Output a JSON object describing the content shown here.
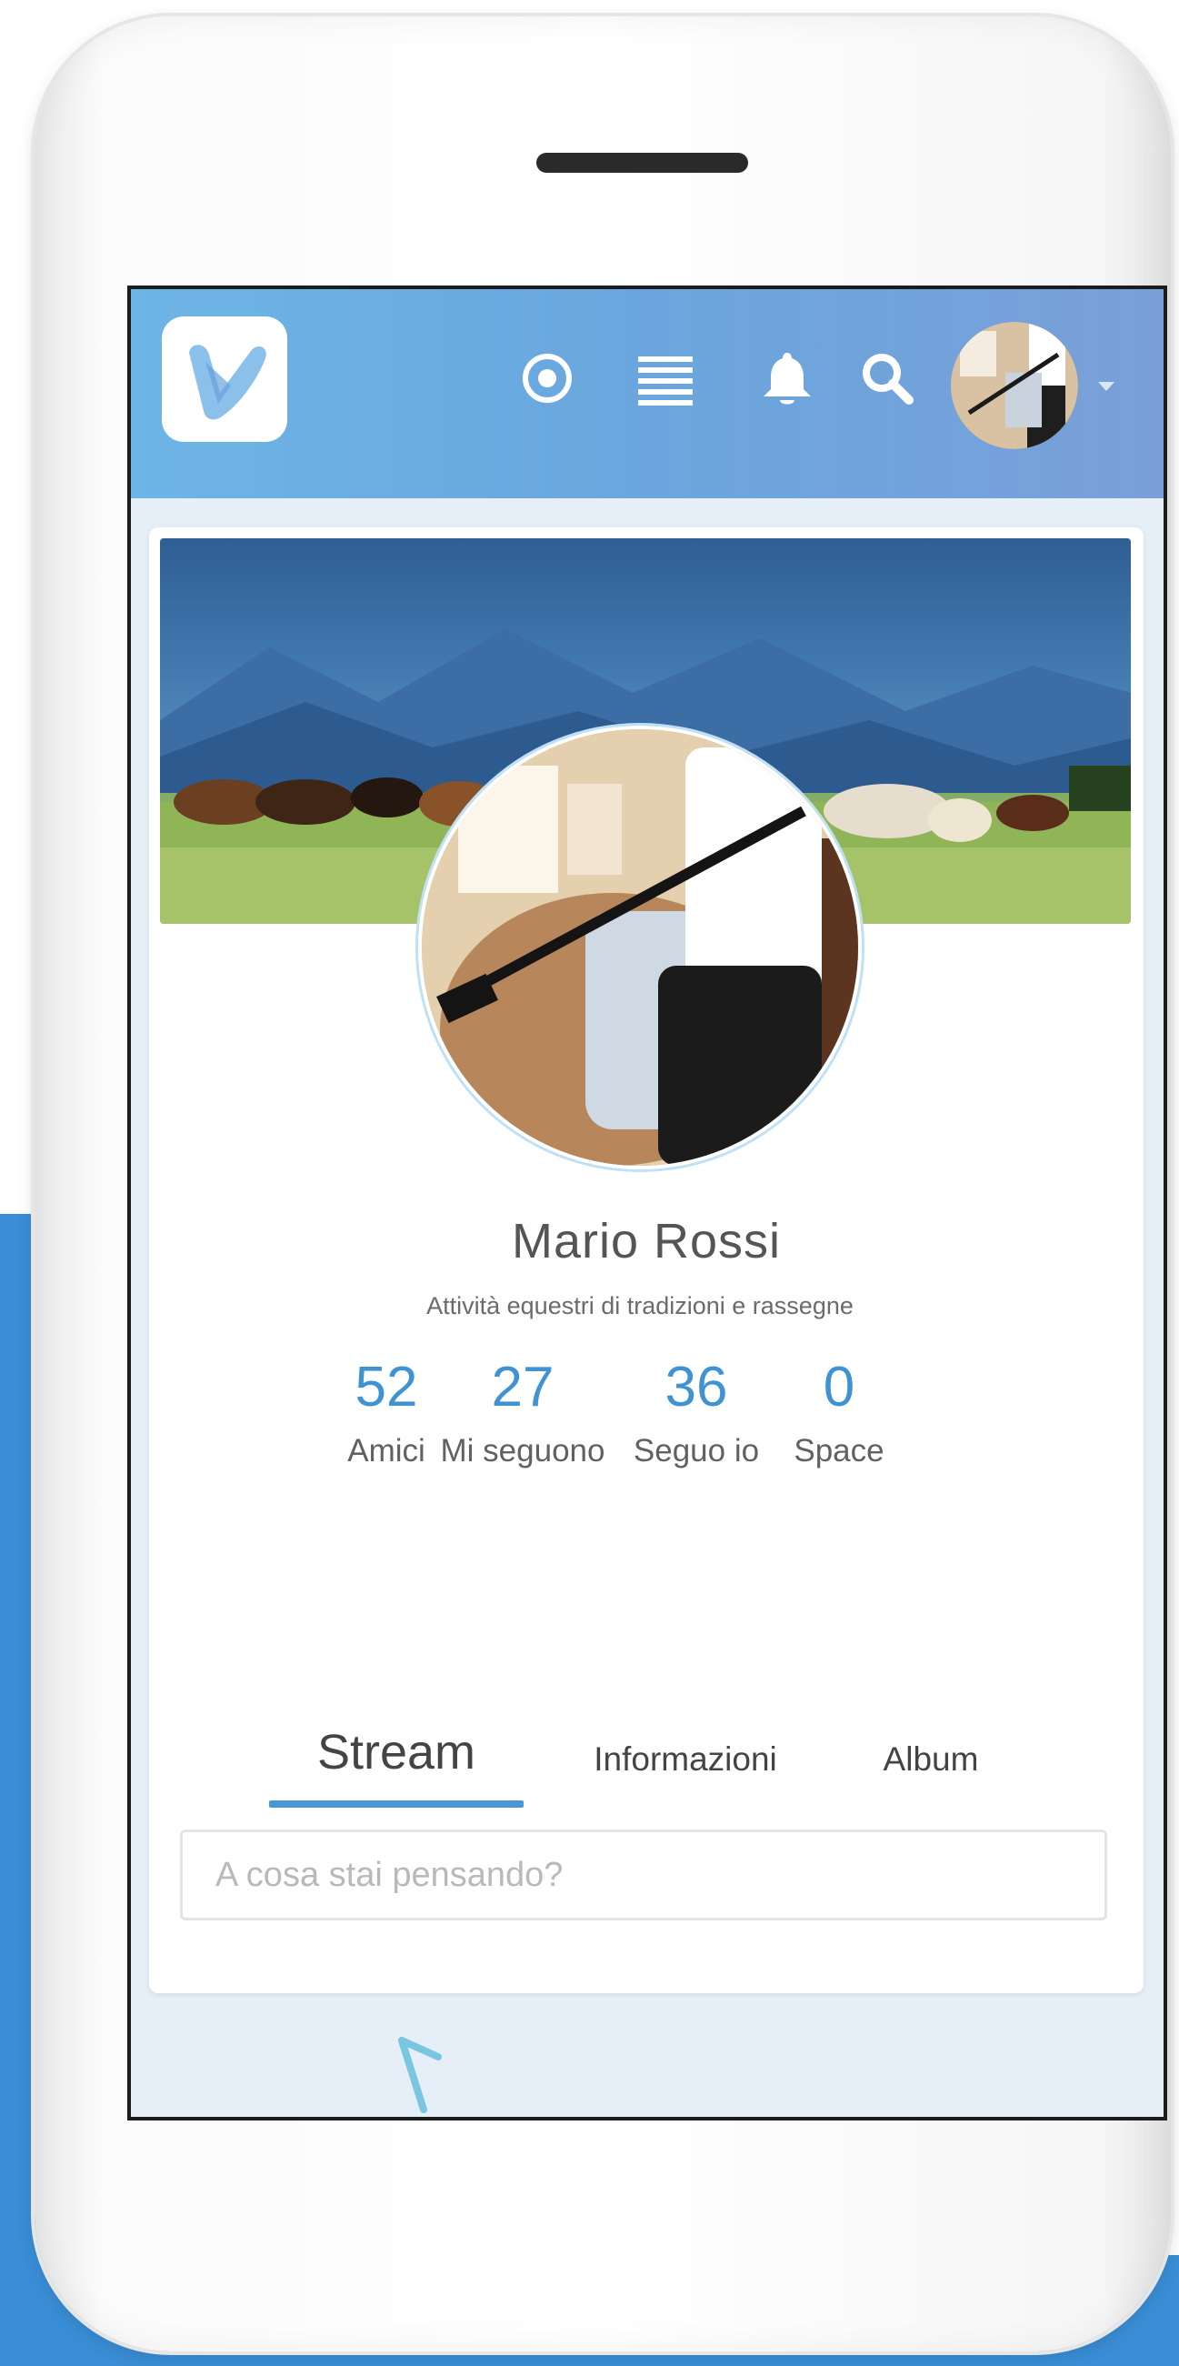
{
  "app": {
    "logo_letter": "V",
    "header_icons": [
      "target-icon",
      "menu-lines-icon",
      "bell-icon",
      "search-icon",
      "avatar"
    ],
    "accent_color": "#3f93d3"
  },
  "profile": {
    "name": "Mario Rossi",
    "bio": "Attività equestri di tradizioni e rassegne",
    "stats": [
      {
        "value": "52",
        "label": "Amici"
      },
      {
        "value": "27",
        "label": "Mi seguono"
      },
      {
        "value": "36",
        "label": "Seguo io"
      },
      {
        "value": "0",
        "label": "Space"
      }
    ]
  },
  "tabs": [
    {
      "label": "Stream",
      "active": true
    },
    {
      "label": "Informazioni",
      "active": false
    },
    {
      "label": "Album",
      "active": false
    }
  ],
  "composer": {
    "placeholder": "A cosa stai pensando?"
  }
}
